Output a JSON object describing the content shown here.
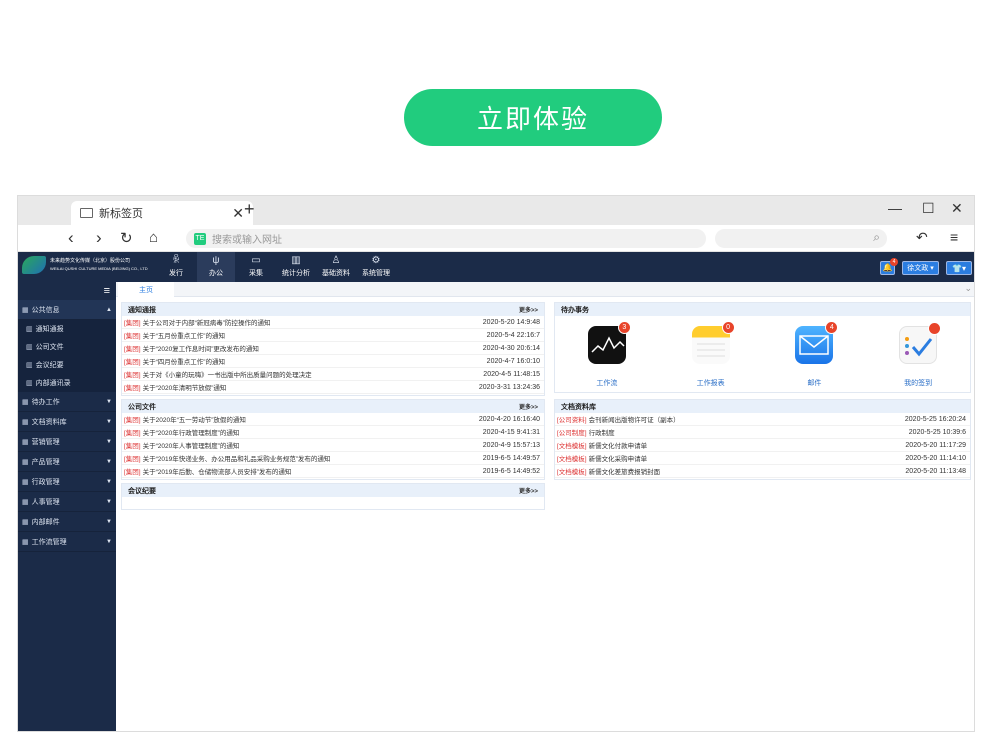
{
  "cta": {
    "label": "立即体验"
  },
  "browser": {
    "tab_title": "新标签页",
    "url_placeholder": "搜索或输入网址",
    "url_badge": "TE"
  },
  "app": {
    "logo_line1": "未来趋势文化传媒（北京）股份公司",
    "logo_line2": "WEILAI QUSHI CULTURE MEDIA (BEIJING) CO., LTD",
    "menus": [
      {
        "icon": "users-icon",
        "label": "发行",
        "glyph": "ꆜ"
      },
      {
        "icon": "office-icon",
        "label": "办公",
        "glyph": "ψ"
      },
      {
        "icon": "monitor-icon",
        "label": "采集",
        "glyph": "▭"
      },
      {
        "icon": "chart-icon",
        "label": "统计分析",
        "glyph": "▥"
      },
      {
        "icon": "person-icon",
        "label": "基础资料",
        "glyph": "♙"
      },
      {
        "icon": "settings-icon",
        "label": "系统管理",
        "glyph": "⚙"
      }
    ],
    "notify_count": "4",
    "user": "徐文政 ▾",
    "skin": "👕▾"
  },
  "sidebar": {
    "groups": [
      {
        "label": "公共信息",
        "open": true
      },
      {
        "label": "待办工作"
      },
      {
        "label": "文档资料库"
      },
      {
        "label": "营销管理"
      },
      {
        "label": "产品管理"
      },
      {
        "label": "行政管理"
      },
      {
        "label": "人事管理"
      },
      {
        "label": "内部邮件"
      },
      {
        "label": "工作流管理"
      }
    ],
    "subitems": [
      "通知通报",
      "公司文件",
      "会议纪要",
      "内部通讯录"
    ]
  },
  "content": {
    "tab": "主页",
    "more": "更多>>",
    "notices": {
      "title": "通知通报",
      "rows": [
        {
          "tag": "[集团]",
          "text": "关于公司对于内部“新冠病毒”防控操作的通知",
          "date": "2020-5-20 14:9:48"
        },
        {
          "tag": "[集团]",
          "text": "关于“五月份重点工作”的通知",
          "date": "2020-5-4 22:16:7"
        },
        {
          "tag": "[集团]",
          "text": "关于“2020复工作息时间”更改发布的通知",
          "date": "2020-4-30 20:6:14"
        },
        {
          "tag": "[集团]",
          "text": "关于“四月份重点工作”的通知",
          "date": "2020-4-7 16:0:10"
        },
        {
          "tag": "[集团]",
          "text": "关于对《小童的玩嗨》一书出版中所出质量问题的处理决定",
          "date": "2020-4-5 11:48:15"
        },
        {
          "tag": "[集团]",
          "text": "关于“2020年清明节放假”通知",
          "date": "2020-3-31 13:24:36"
        }
      ]
    },
    "files": {
      "title": "公司文件",
      "rows": [
        {
          "tag": "[集团]",
          "text": "关于2020年“五一劳动节”放假的通知",
          "date": "2020-4-20 16:16:40"
        },
        {
          "tag": "[集团]",
          "text": "关于“2020年行政管理制度”的通知",
          "date": "2020-4-15 9:41:31"
        },
        {
          "tag": "[集团]",
          "text": "关于“2020年人事管理制度”的通知",
          "date": "2020-4-9 15:57:13"
        },
        {
          "tag": "[集团]",
          "text": "关于“2019年快递业务、办公用品和礼品采购业务规范”发布的通知",
          "date": "2019-6-5 14:49:57"
        },
        {
          "tag": "[集团]",
          "text": "关于“2019年后勤、仓储物流部人员安排”发布的通知",
          "date": "2019-6-5 14:49:52"
        }
      ]
    },
    "meetings": {
      "title": "会议纪要"
    },
    "todo": {
      "title": "待办事务",
      "items": [
        {
          "icon": "workflow-icon",
          "label": "工作流",
          "badge": "3"
        },
        {
          "icon": "report-icon",
          "label": "工作报表",
          "badge": "0"
        },
        {
          "icon": "mail-icon",
          "label": "邮件",
          "badge": "4"
        },
        {
          "icon": "checkin-icon",
          "label": "我的签到",
          "badge": ""
        }
      ]
    },
    "docs": {
      "title": "文档资料库",
      "rows": [
        {
          "tag": "[公司资料]",
          "text": "会刊新闻出版物许可证（副本）",
          "date": "2020-5-25 16:20:24"
        },
        {
          "tag": "[公司制度]",
          "text": "行政制度",
          "date": "2020-5-25 10:39:6"
        },
        {
          "tag": "[文档模板]",
          "text": "新儒文化付款申请单",
          "date": "2020-5-20 11:17:29"
        },
        {
          "tag": "[文档模板]",
          "text": "新儒文化采购申请单",
          "date": "2020-5-20 11:14:10"
        },
        {
          "tag": "[文档模板]",
          "text": "新儒文化差旅费报销封面",
          "date": "2020-5-20 11:13:48"
        }
      ]
    }
  }
}
